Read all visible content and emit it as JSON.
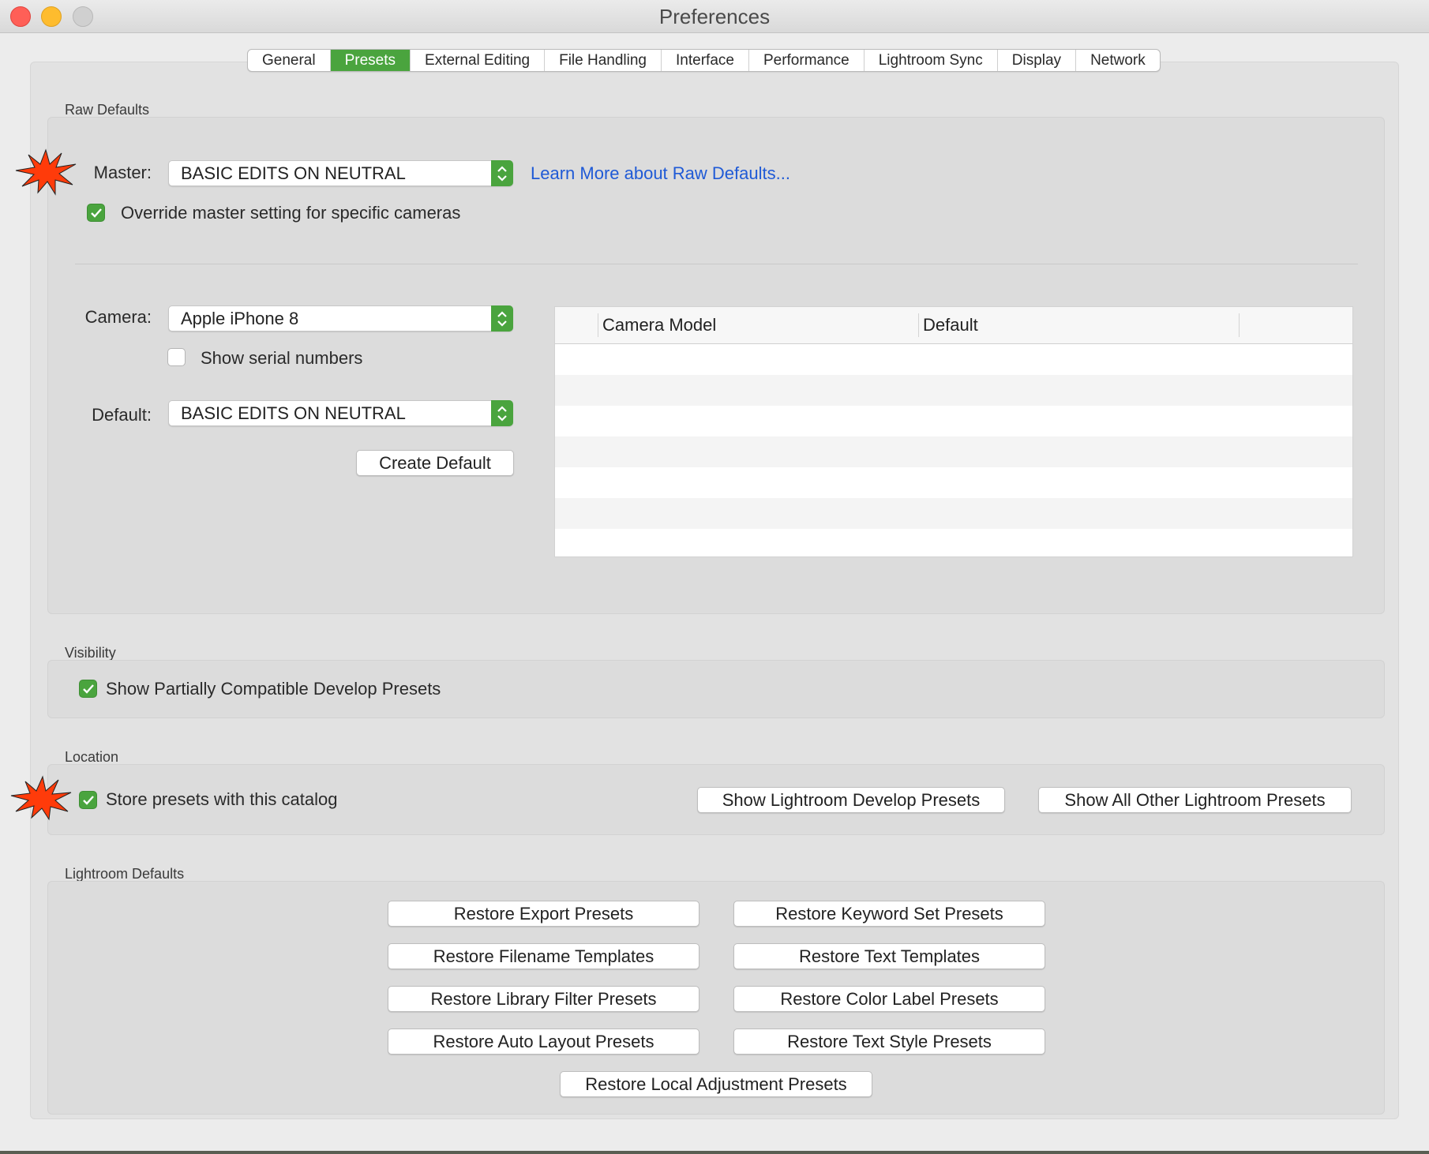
{
  "window": {
    "title": "Preferences"
  },
  "tabs": [
    {
      "label": "General",
      "active": false
    },
    {
      "label": "Presets",
      "active": true
    },
    {
      "label": "External Editing",
      "active": false
    },
    {
      "label": "File Handling",
      "active": false
    },
    {
      "label": "Interface",
      "active": false
    },
    {
      "label": "Performance",
      "active": false
    },
    {
      "label": "Lightroom Sync",
      "active": false
    },
    {
      "label": "Display",
      "active": false
    },
    {
      "label": "Network",
      "active": false
    }
  ],
  "raw_defaults": {
    "section_label": "Raw Defaults",
    "master_label": "Master:",
    "master_value": "BASIC EDITS ON NEUTRAL",
    "learn_more_link": "Learn More about Raw Defaults...",
    "override_label": "Override master setting for specific cameras",
    "override_checked": true,
    "camera_label": "Camera:",
    "camera_value": "Apple iPhone 8",
    "show_serial_label": "Show serial numbers",
    "show_serial_checked": false,
    "default_label": "Default:",
    "default_value": "BASIC EDITS ON NEUTRAL",
    "create_default_button": "Create Default",
    "table": {
      "columns": [
        "Camera Model",
        "Default"
      ],
      "rows": []
    }
  },
  "visibility": {
    "section_label": "Visibility",
    "show_partial_label": "Show Partially Compatible Develop Presets",
    "show_partial_checked": true
  },
  "location": {
    "section_label": "Location",
    "store_label": "Store presets with this catalog",
    "store_checked": true,
    "show_develop_button": "Show Lightroom Develop Presets",
    "show_other_button": "Show All Other Lightroom Presets"
  },
  "lightroom_defaults": {
    "section_label": "Lightroom Defaults",
    "buttons": [
      "Restore Export Presets",
      "Restore Keyword Set Presets",
      "Restore Filename Templates",
      "Restore Text Templates",
      "Restore Library Filter Presets",
      "Restore Color Label Presets",
      "Restore Auto Layout Presets",
      "Restore Text Style Presets",
      "Restore Local Adjustment Presets"
    ]
  },
  "colors": {
    "accent": "#4aa43e",
    "link": "#1f5ad6",
    "starburst": "#ff3b0a"
  },
  "icons": [
    "starburst-icon",
    "checkmark-icon",
    "updown-chevron-icon"
  ]
}
